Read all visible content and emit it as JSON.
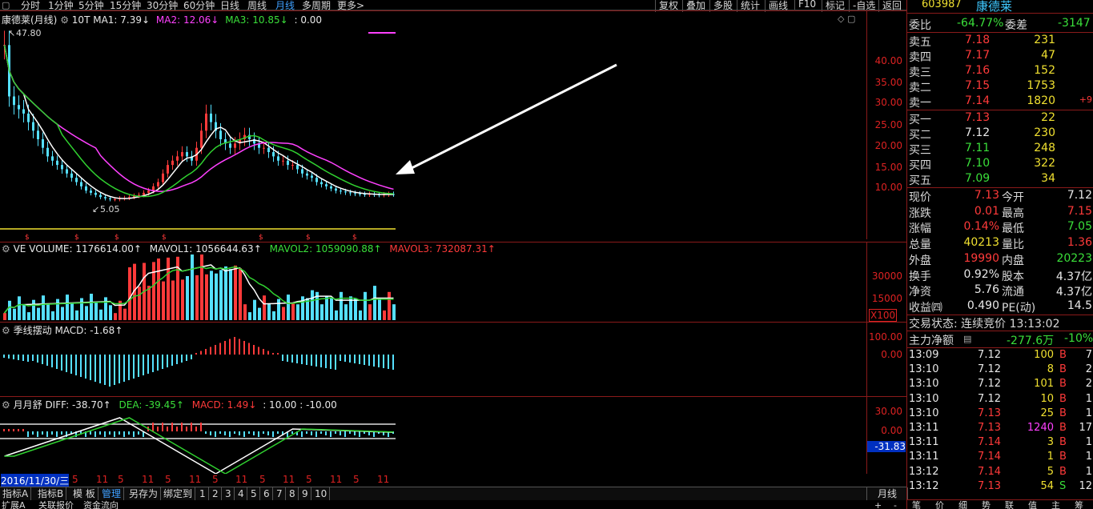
{
  "periods": [
    "分时",
    "1分钟",
    "5分钟",
    "15分钟",
    "30分钟",
    "60分钟",
    "日线",
    "周线",
    "月线",
    "多周期",
    "更多>"
  ],
  "active_period": "月线",
  "toolbar": [
    "复权",
    "叠加",
    "多股",
    "统计",
    "画线",
    "F10",
    "标记",
    "-自选",
    "返回"
  ],
  "main_chart": {
    "title": "康德莱(月线)",
    "ma_label": "10T",
    "ma1": "MA1: 7.39↓",
    "ma2": "MA2: 12.06↓",
    "ma3": "MA3: 10.85↓",
    "extra": ": 0.00",
    "high_label": "47.80",
    "low_label": "5.05",
    "y_ticks": [
      "40.00",
      "35.00",
      "30.00",
      "25.00",
      "20.00",
      "15.00",
      "10.00"
    ]
  },
  "volume_panel": {
    "label": "VE",
    "volume": "VOLUME: 1176614.00↑",
    "mavol1": "MAVOL1: 1056644.63↑",
    "mavol2": "MAVOL2: 1059090.88↑",
    "mavol3": "MAVOL3: 732087.31↑",
    "y_ticks": [
      "30000",
      "15000"
    ],
    "unit": "X100"
  },
  "macd_panel": {
    "title": "季线摆动",
    "macd": "MACD: -1.68↑",
    "y_ticks": [
      "100.00",
      "0.00"
    ]
  },
  "yys_panel": {
    "title": "月月舒",
    "diff": "DIFF: -38.70↑",
    "dea": "DEA: -39.45↑",
    "macd": "MACD: 1.49↓",
    "extra": ": 10.00 : -10.00",
    "y_ticks": [
      "30.00",
      "0.00"
    ],
    "current": "-31.83"
  },
  "date_axis": {
    "first": "2016/11/30/三",
    "labels": [
      "5",
      "11",
      "5",
      "11",
      "5",
      "11",
      "5",
      "11",
      "5",
      "11",
      "5",
      "11",
      "5",
      "11",
      "5",
      "11"
    ]
  },
  "bottom_tabs": [
    "指标A",
    "指标B",
    "模 板",
    "管理",
    "另存为",
    "绑定到",
    "1",
    "2",
    "3",
    "4",
    "5",
    "6",
    "7",
    "8",
    "9",
    "10"
  ],
  "bottom_right": "月线",
  "bottom_row2": [
    "扩展A",
    "关联报价",
    "资金流向"
  ],
  "quote": {
    "code": "603987",
    "name": "康德莱",
    "weibi": {
      "label": "委比",
      "value": "-64.77%"
    },
    "weicha": {
      "label": "委差",
      "value": "-3147"
    },
    "asks": [
      {
        "label": "卖五",
        "price": "7.18",
        "vol": "231",
        "chg": ""
      },
      {
        "label": "卖四",
        "price": "7.17",
        "vol": "47",
        "chg": ""
      },
      {
        "label": "卖三",
        "price": "7.16",
        "vol": "152",
        "chg": ""
      },
      {
        "label": "卖二",
        "price": "7.15",
        "vol": "1753",
        "chg": ""
      },
      {
        "label": "卖一",
        "price": "7.14",
        "vol": "1820",
        "chg": "+9"
      }
    ],
    "bids": [
      {
        "label": "买一",
        "price": "7.13",
        "vol": "22"
      },
      {
        "label": "买二",
        "price": "7.12",
        "vol": "230"
      },
      {
        "label": "买三",
        "price": "7.11",
        "vol": "248"
      },
      {
        "label": "买四",
        "price": "7.10",
        "vol": "322"
      },
      {
        "label": "买五",
        "price": "7.09",
        "vol": "34"
      }
    ],
    "stats": [
      {
        "l1": "现价",
        "v1": "7.13",
        "c1": "red",
        "l2": "今开",
        "v2": "7.12",
        "c2": "white"
      },
      {
        "l1": "涨跌",
        "v1": "0.01",
        "c1": "red",
        "l2": "最高",
        "v2": "7.15",
        "c2": "red"
      },
      {
        "l1": "涨幅",
        "v1": "0.14%",
        "c1": "red",
        "l2": "最低",
        "v2": "7.05",
        "c2": "green"
      },
      {
        "l1": "总量",
        "v1": "40213",
        "c1": "yellow",
        "l2": "量比",
        "v2": "1.36",
        "c2": "red"
      },
      {
        "l1": "外盘",
        "v1": "19990",
        "c1": "red",
        "l2": "内盘",
        "v2": "20223",
        "c2": "green"
      },
      {
        "l1": "换手",
        "v1": "0.92%",
        "c1": "white",
        "l2": "股本",
        "v2": "4.37亿",
        "c2": "white"
      },
      {
        "l1": "净资",
        "v1": "5.76",
        "c1": "white",
        "l2": "流通",
        "v2": "4.37亿",
        "c2": "white"
      },
      {
        "l1": "收益㈣",
        "v1": "0.490",
        "c1": "white",
        "l2": "PE(动)",
        "v2": "14.5",
        "c2": "white"
      }
    ],
    "trade_status": "交易状态: 连续竞价 13:13:02",
    "main_fund": {
      "label": "主力净额",
      "value": "-277.6万",
      "pct": "-10%"
    },
    "ticks": [
      {
        "t": "13:09",
        "p": "7.12",
        "v": "100",
        "bs": "B",
        "n": "7",
        "pc": "white",
        "vc": "yellow"
      },
      {
        "t": "13:10",
        "p": "7.12",
        "v": "8",
        "bs": "B",
        "n": "2",
        "pc": "white",
        "vc": "yellow"
      },
      {
        "t": "13:10",
        "p": "7.12",
        "v": "101",
        "bs": "B",
        "n": "2",
        "pc": "white",
        "vc": "yellow"
      },
      {
        "t": "13:10",
        "p": "7.12",
        "v": "10",
        "bs": "B",
        "n": "1",
        "pc": "white",
        "vc": "yellow"
      },
      {
        "t": "13:10",
        "p": "7.13",
        "v": "25",
        "bs": "B",
        "n": "1",
        "pc": "red",
        "vc": "yellow"
      },
      {
        "t": "13:11",
        "p": "7.13",
        "v": "1240",
        "bs": "B",
        "n": "17",
        "pc": "red",
        "vc": "mag"
      },
      {
        "t": "13:11",
        "p": "7.14",
        "v": "3",
        "bs": "B",
        "n": "1",
        "pc": "red",
        "vc": "yellow"
      },
      {
        "t": "13:11",
        "p": "7.14",
        "v": "1",
        "bs": "B",
        "n": "1",
        "pc": "red",
        "vc": "yellow"
      },
      {
        "t": "13:12",
        "p": "7.14",
        "v": "5",
        "bs": "B",
        "n": "1",
        "pc": "red",
        "vc": "yellow"
      },
      {
        "t": "13:12",
        "p": "7.13",
        "v": "54",
        "bs": "S",
        "n": "12",
        "pc": "red",
        "vc": "yellow"
      }
    ],
    "bottom_tabs": [
      "笔",
      "价",
      "细",
      "势",
      "联",
      "值",
      "主",
      "筹"
    ]
  },
  "colors": {
    "up": "#ff3a3a",
    "down": "#55e0ff",
    "ma1": "#ffffff",
    "ma2": "#ff40ff",
    "ma3": "#30d030",
    "axis": "#8a1a1a"
  }
}
